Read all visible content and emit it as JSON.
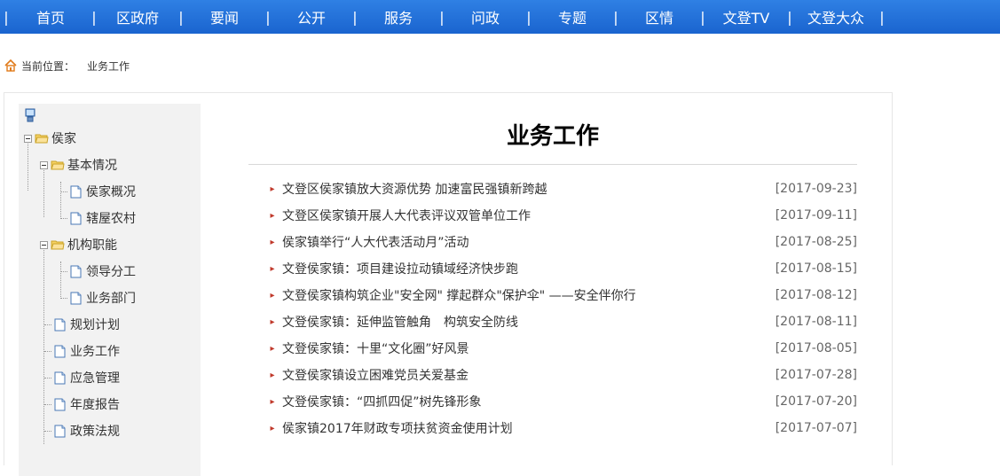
{
  "nav": {
    "items": [
      "首页",
      "区政府",
      "要闻",
      "公开",
      "服务",
      "问政",
      "专题",
      "区情",
      "文登TV",
      "文登大众"
    ],
    "separator": "|"
  },
  "breadcrumb": {
    "icon": "home-icon",
    "label": "当前位置：",
    "current": "业务工作"
  },
  "sidebar": {
    "root_icon": "computer-icon",
    "tree": [
      {
        "label": "侯家",
        "type": "folder",
        "level": 0
      },
      {
        "label": "基本情况",
        "type": "folder",
        "level": 1
      },
      {
        "label": "侯家概况",
        "type": "doc",
        "level": 2
      },
      {
        "label": "辖屋农村",
        "type": "doc",
        "level": 2
      },
      {
        "label": "机构职能",
        "type": "folder",
        "level": 1
      },
      {
        "label": "领导分工",
        "type": "doc",
        "level": 2
      },
      {
        "label": "业务部门",
        "type": "doc",
        "level": 2
      },
      {
        "label": "规划计划",
        "type": "doc",
        "level": 1
      },
      {
        "label": "业务工作",
        "type": "doc",
        "level": 1
      },
      {
        "label": "应急管理",
        "type": "doc",
        "level": 1
      },
      {
        "label": "年度报告",
        "type": "doc",
        "level": 1
      },
      {
        "label": "政策法规",
        "type": "doc",
        "level": 1
      }
    ]
  },
  "content": {
    "title": "业务工作",
    "articles": [
      {
        "title": "文登区侯家镇放大资源优势 加速富民强镇新跨越",
        "date": "[2017-09-23]"
      },
      {
        "title": "文登区侯家镇开展人大代表评议双管单位工作",
        "date": "[2017-09-11]"
      },
      {
        "title": "侯家镇举行“人大代表活动月”活动",
        "date": "[2017-08-25]"
      },
      {
        "title": "文登侯家镇：项目建设拉动镇域经济快步跑",
        "date": "[2017-08-15]"
      },
      {
        "title": "文登侯家镇构筑企业\"安全网\" 撑起群众\"保护伞\" ——安全伴你行",
        "date": "[2017-08-12]"
      },
      {
        "title": "文登侯家镇：延伸监管触角　构筑安全防线",
        "date": "[2017-08-11]"
      },
      {
        "title": "文登侯家镇：十里“文化圈”好风景",
        "date": "[2017-08-05]"
      },
      {
        "title": "文登侯家镇设立困难党员关爱基金",
        "date": "[2017-07-28]"
      },
      {
        "title": "文登侯家镇：“四抓四促”树先锋形象",
        "date": "[2017-07-20]"
      },
      {
        "title": "侯家镇2017年财政专项扶贫资金使用计划",
        "date": "[2017-07-07]"
      }
    ]
  },
  "colors": {
    "nav_bg": "#1a64cf",
    "bullet": "#c0392b",
    "sidebar_bg": "#f2f2f2"
  }
}
